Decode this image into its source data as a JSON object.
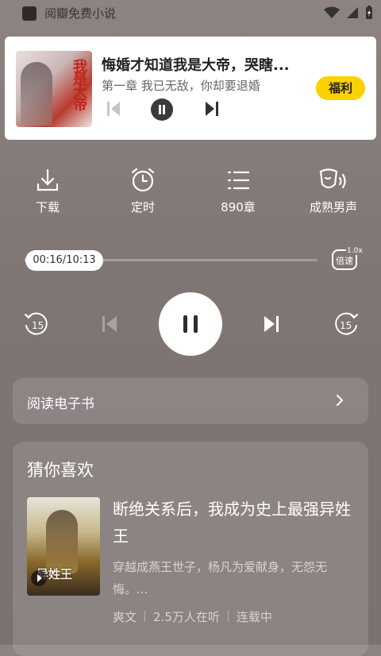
{
  "status_bar": {
    "app_name": "阅瓣免费小说"
  },
  "notification": {
    "title": "悔婚才知道我是大帝，哭瞎...",
    "subtitle": "第一章 我已无敌，你却要退婚",
    "welfare_button": "福利",
    "cover_text": "我是大帝",
    "cover_icon": "book-cover"
  },
  "functions": [
    {
      "label": "下载",
      "icon": "download-icon"
    },
    {
      "label": "定时",
      "icon": "alarm-clock-icon"
    },
    {
      "label": "890章",
      "icon": "chapter-list-icon"
    },
    {
      "label": "成熟男声",
      "icon": "voice-icon"
    }
  ],
  "player": {
    "time": "00:16/10:13",
    "progress_fraction": 0.026,
    "speed_label": "倍速",
    "speed_value": "1.0x",
    "rewind": "15",
    "forward": "15"
  },
  "read_ebook": {
    "label": "阅读电子书"
  },
  "recommendations": {
    "heading": "猜你喜欢",
    "items": [
      {
        "title": "断绝关系后，我成为史上最强异姓王",
        "description": "穿越成燕王世子，杨凡为爱献身，无怨无悔。...",
        "cover_text": "异姓王",
        "genre": "爽文",
        "listeners": "2.5万人在听",
        "status": "连载中"
      }
    ]
  },
  "colors": {
    "accent": "#fbd200",
    "background": "#847b79"
  }
}
